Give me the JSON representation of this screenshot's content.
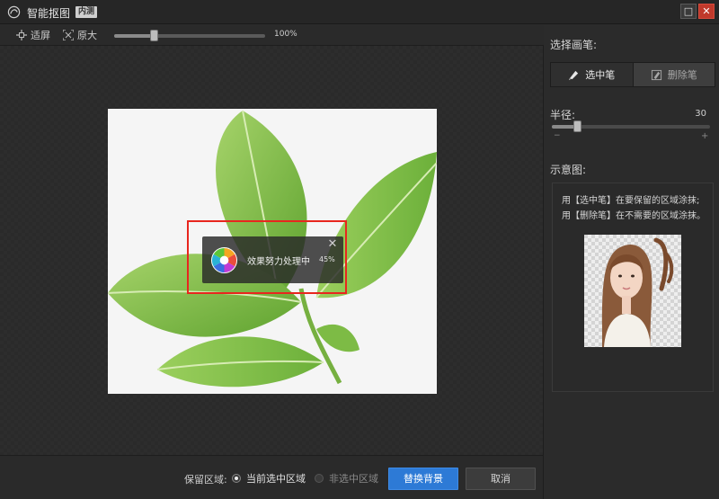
{
  "window": {
    "title": "智能抠图",
    "badge": "内测",
    "maximize_glyph": "□",
    "close_glyph": "✕",
    "icon": "app-logo-icon"
  },
  "toolbar": {
    "fit_label": "适屏",
    "fit_icon": "fit-screen-icon",
    "original_label": "原大",
    "original_icon": "original-size-icon",
    "zoom_value": "100%"
  },
  "progress": {
    "text": "效果努力处理中",
    "percent": "45%",
    "close_glyph": "✕",
    "icon": "loading-spinner-icon"
  },
  "bottom": {
    "keep_area_label": "保留区域:",
    "radio_current": "当前选中区域",
    "radio_other": "非选中区域",
    "replace_bg_button": "替换背景",
    "cancel_button": "取消"
  },
  "sidebar": {
    "choose_brush_heading": "选择画笔:",
    "brush_select_label": "选中笔",
    "brush_select_icon": "select-brush-icon",
    "brush_erase_label": "删除笔",
    "brush_erase_icon": "erase-brush-icon",
    "radius_label": "半径:",
    "radius_value": "30",
    "radius_minus": "−",
    "radius_plus": "+",
    "demo_heading": "示意图:",
    "demo_line1": "用【选中笔】在要保留的区域涂抹;",
    "demo_line2": "用【删除笔】在不需要的区域涂抹。"
  },
  "colors": {
    "accent_blue": "#2d7ad6",
    "highlight_red": "#e8261e",
    "close_red": "#c0392b"
  },
  "state": {
    "zoom_level": "100%",
    "radius": 30,
    "progress_percent": 45,
    "active_brush": "选中笔",
    "keep_area": "当前选中区域"
  }
}
